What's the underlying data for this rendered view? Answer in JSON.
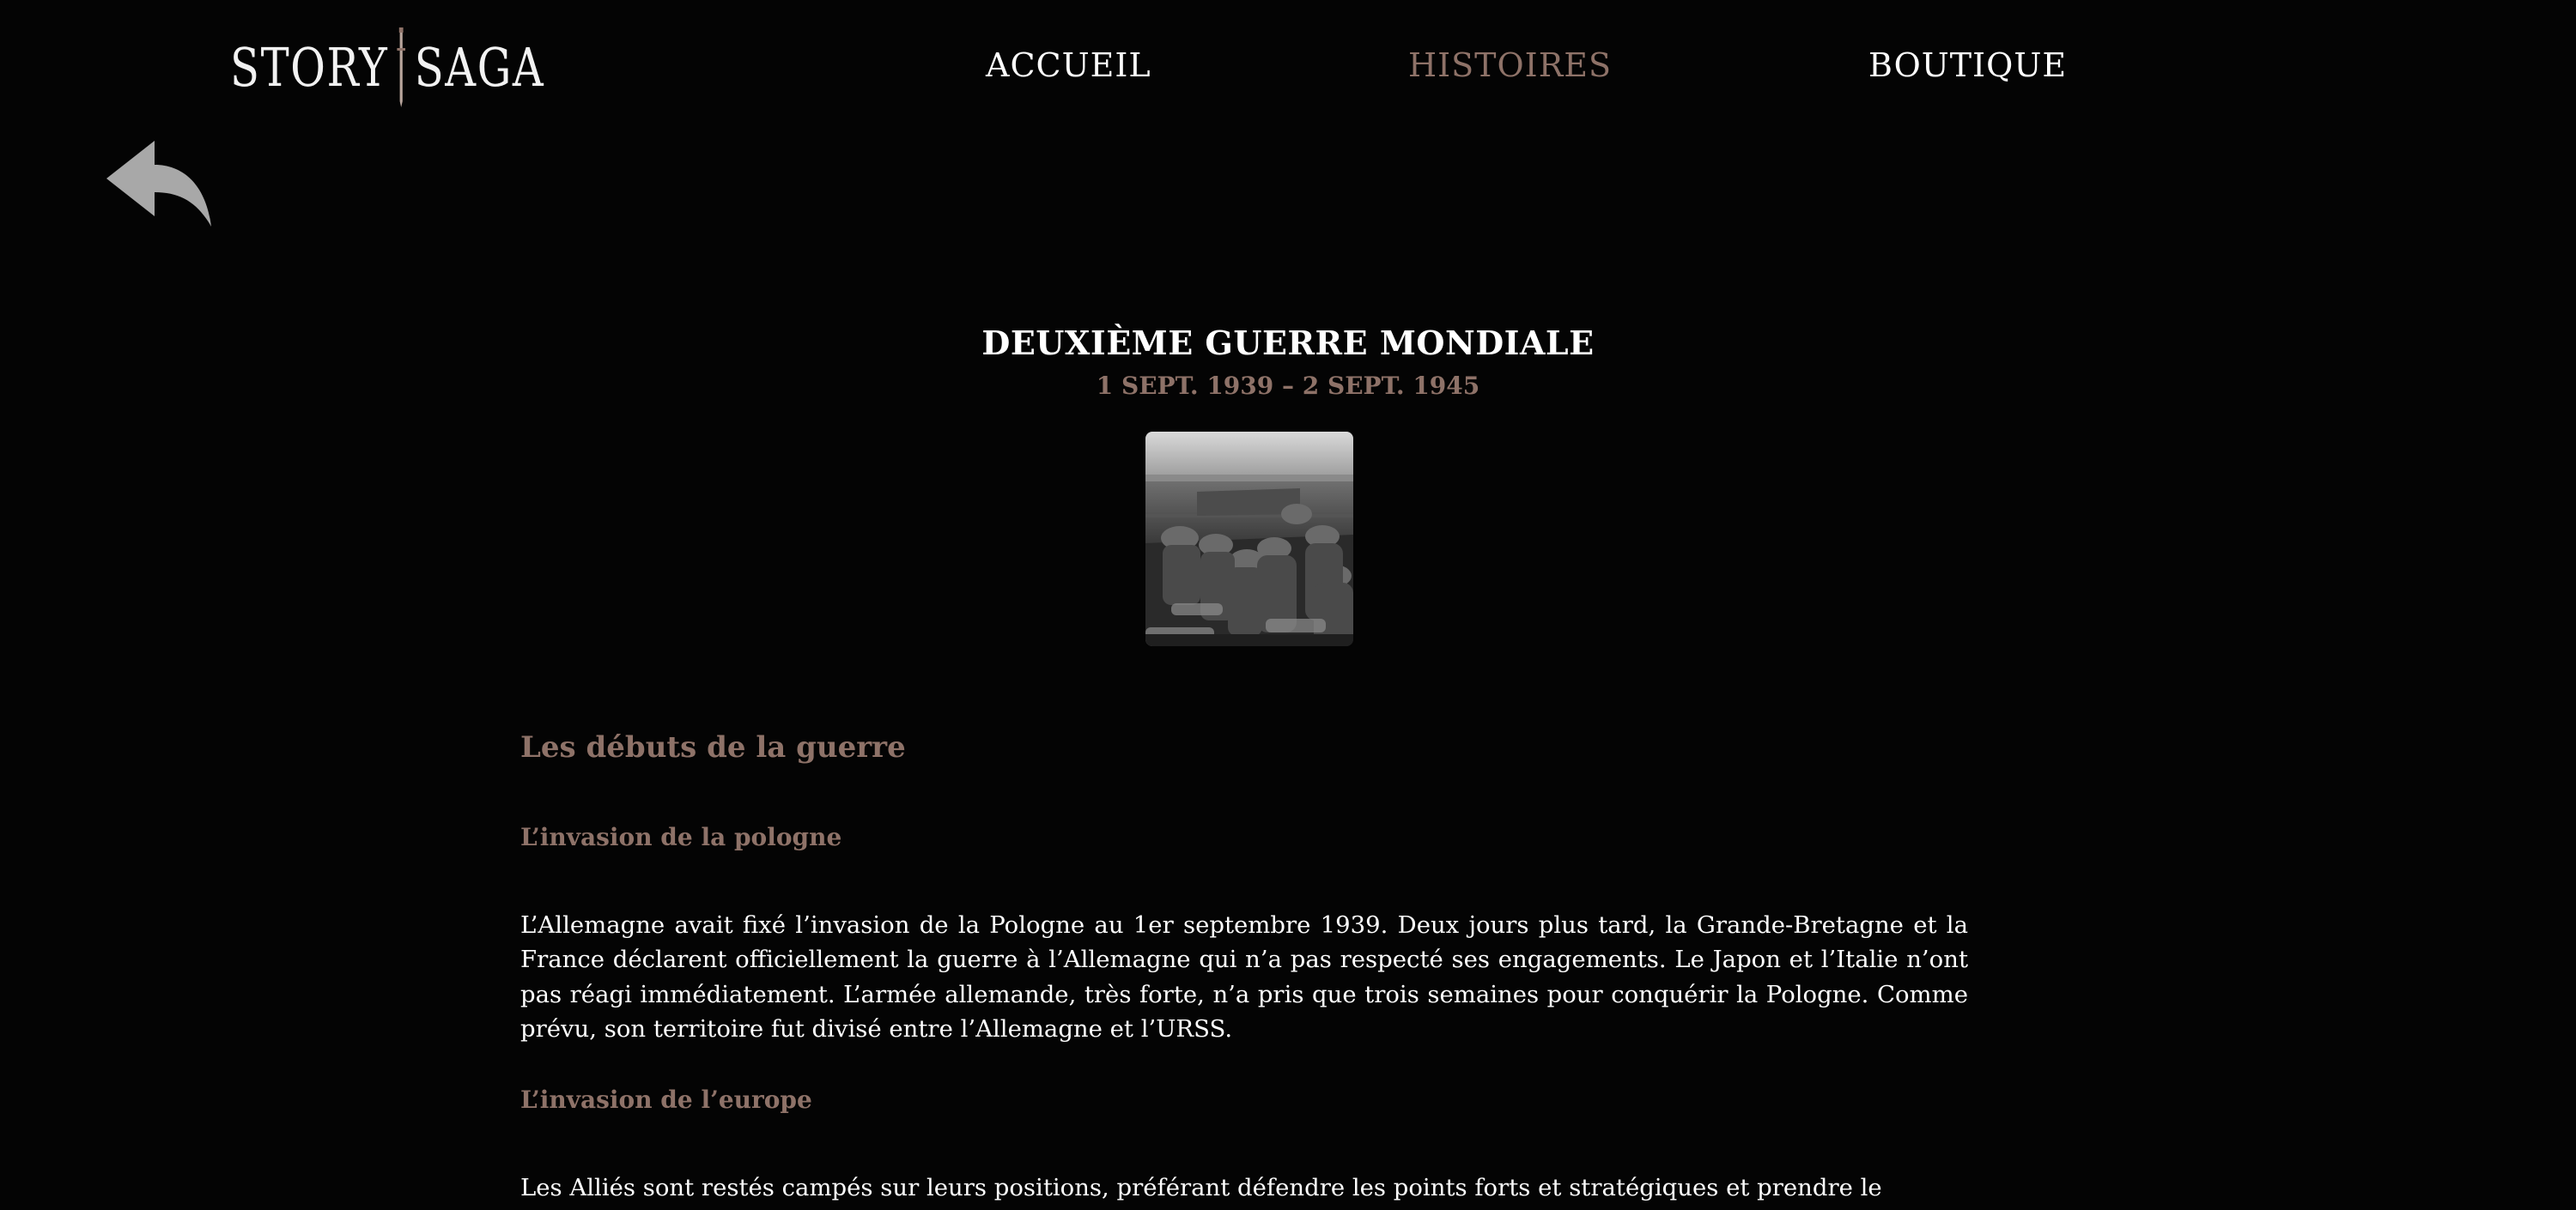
{
  "header": {
    "logo": {
      "left": "STORY",
      "right": "SAGA",
      "icon": "sword-icon"
    },
    "nav": [
      {
        "label": "ACCUEIL",
        "active": false
      },
      {
        "label": "HISTOIRES",
        "active": true
      },
      {
        "label": "BOUTIQUE",
        "active": false
      }
    ]
  },
  "back_button": {
    "icon": "reply-arrow-icon"
  },
  "story": {
    "title": "DEUXIÈME GUERRE MONDIALE",
    "dates": "1 SEPT. 1939 – 2 SEPT. 1945",
    "image": {
      "icon": "soldiers-landing-craft-photo"
    }
  },
  "content": {
    "section_title": "Les débuts de la guerre",
    "subsections": [
      {
        "title": "L’invasion de la pologne",
        "text": "L’Allemagne avait fixé l’invasion de la Pologne au 1er septembre 1939. Deux jours plus tard, la Grande-Bretagne et la France déclarent officiellement la guerre à l’Allemagne qui n’a pas respecté ses engagements. Le Japon et l’Italie n’ont pas réagi immédiatement. L’armée allemande, très forte, n’a pris que trois semaines pour conquérir la Pologne. Comme prévu, son territoire fut divisé entre l’Allemagne et l’URSS."
      },
      {
        "title": "L’invasion de l’europe",
        "text": "Les Alliés sont restés campés sur leurs positions, préférant défendre les points forts et stratégiques et prendre le"
      }
    ]
  },
  "colors": {
    "background": "#040404",
    "accent": "#8e7268",
    "text": "#ffffff",
    "icon_grey": "#a8a8a8"
  }
}
